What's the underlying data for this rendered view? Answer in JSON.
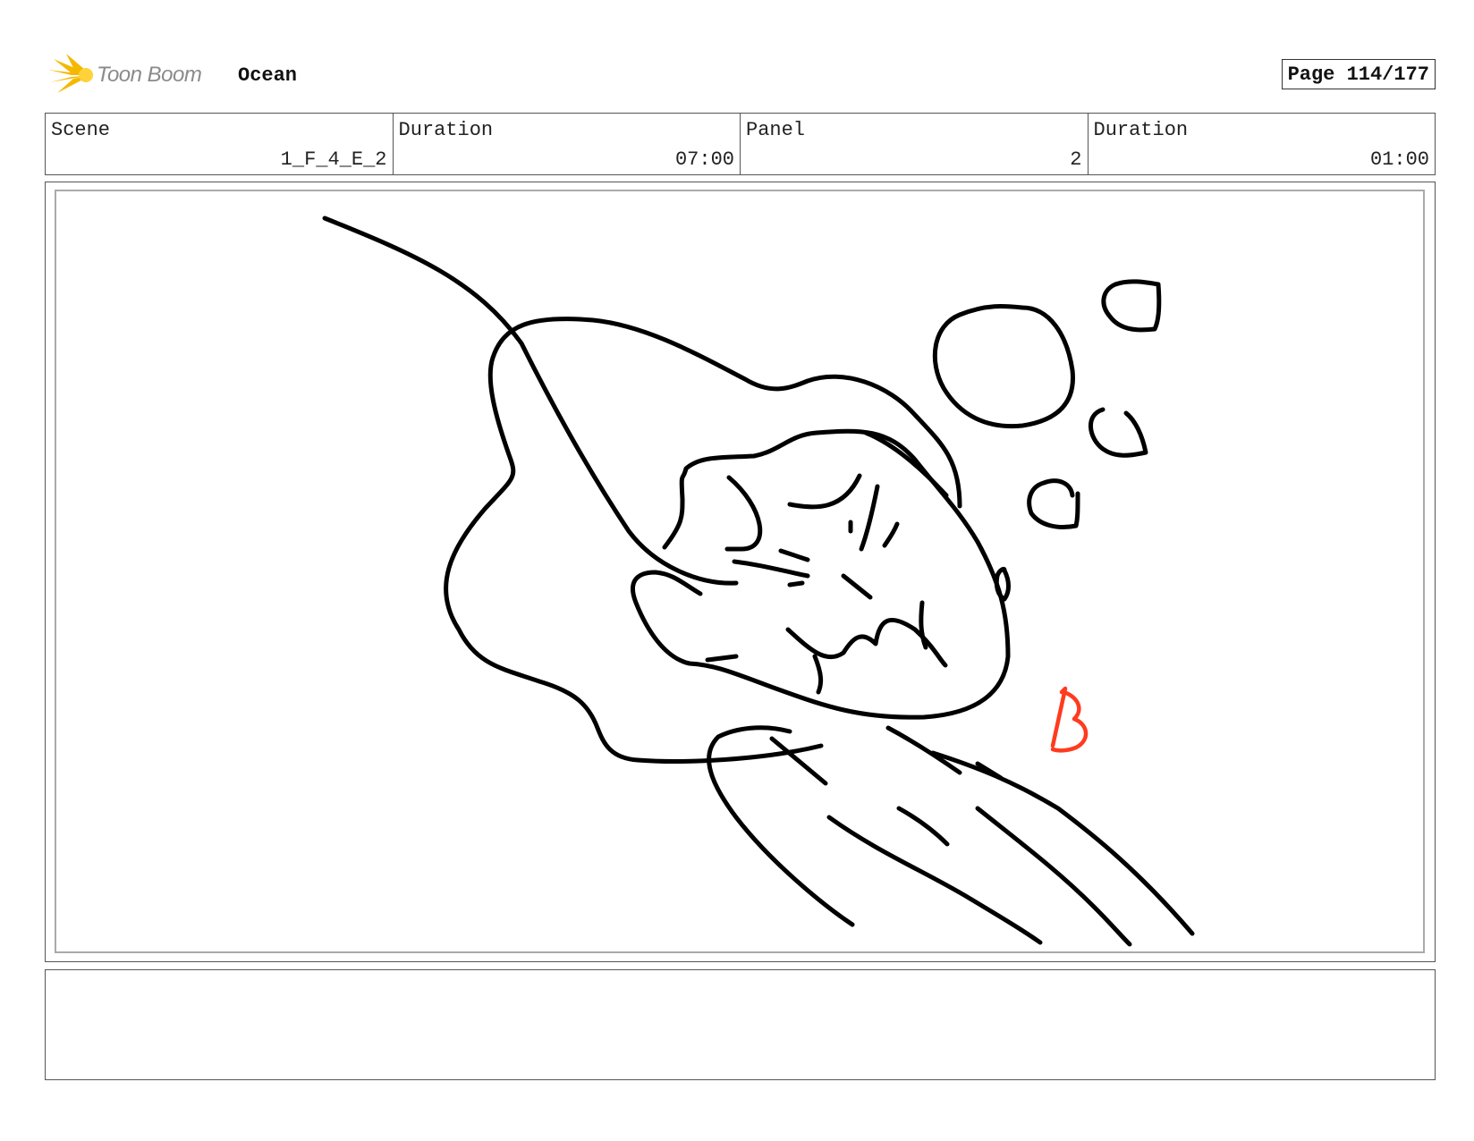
{
  "header": {
    "logo_text": "Toon Boom",
    "project_title": "Ocean",
    "page_label": "Page 114/177"
  },
  "info": {
    "scene_label": "Scene",
    "scene_value": "1_F_4_E_2",
    "scene_duration_label": "Duration",
    "scene_duration_value": "07:00",
    "panel_label": "Panel",
    "panel_value": "2",
    "panel_duration_label": "Duration",
    "panel_duration_value": "01:00"
  },
  "panel": {
    "sketch_annotation": "B",
    "annotation_color": "#ff3b1f",
    "ink_color": "#000000"
  },
  "notes": {
    "text": ""
  }
}
